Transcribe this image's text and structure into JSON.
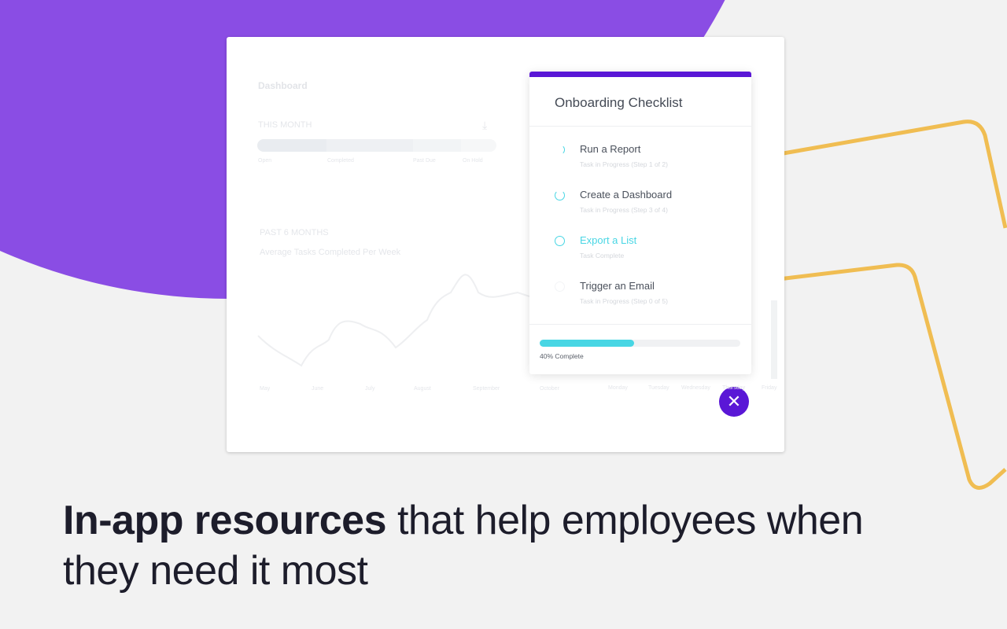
{
  "colors": {
    "purple_bg": "#8a4de4",
    "accent": "#5a17d6",
    "teal": "#48d6e4",
    "gold": "#f0bd52"
  },
  "dashboard": {
    "title": "Dashboard",
    "this_month": "THIS MONTH",
    "segments": [
      "Open",
      "Completed",
      "Past Due",
      "On Hold"
    ],
    "past": "PAST 6 MONTHS",
    "subtitle": "Average Tasks Completed Per Week",
    "months": [
      "May",
      "June",
      "July",
      "August",
      "September",
      "October"
    ],
    "days": [
      "Monday",
      "Tuesday",
      "Wednesday",
      "Thursday",
      "Friday"
    ],
    "download_icon": "download-icon"
  },
  "checklist": {
    "title": "Onboarding Checklist",
    "items": [
      {
        "title": "Run a Report",
        "status": "Task in Progress (Step 1 of 2)",
        "progress": 0.5
      },
      {
        "title": "Create a Dashboard",
        "status": "Task in Progress (Step 3 of 4)",
        "progress": 0.75
      },
      {
        "title": "Export a List",
        "status": "Task Complete",
        "progress": 1
      },
      {
        "title": "Trigger an Email",
        "status": "Task in Progress (Step 0 of 5)",
        "progress": 0
      }
    ],
    "progress_percent": 40,
    "progress_label": "40% Complete",
    "close_icon": "close-icon"
  },
  "headline": {
    "bold": "In-app resources",
    "rest": " that help employees when they need it most"
  }
}
